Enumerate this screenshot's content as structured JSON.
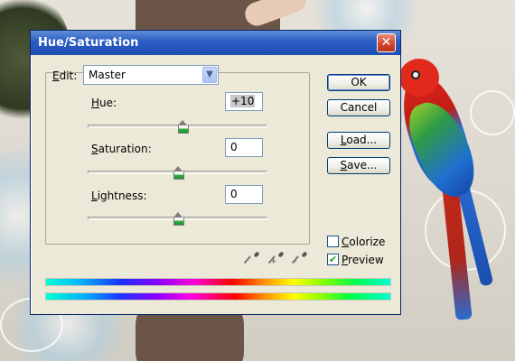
{
  "dialog": {
    "title": "Hue/Saturation",
    "close_glyph": "✕"
  },
  "edit": {
    "label": "Edit:",
    "value": "Master",
    "arrow_glyph": "▼"
  },
  "fields": {
    "hue": {
      "label": "Hue:",
      "value": "+10",
      "slider_value": 10,
      "slider_range": [
        -180,
        180
      ]
    },
    "saturation": {
      "label": "Saturation:",
      "value": "0",
      "slider_value": 0,
      "slider_range": [
        -100,
        100
      ]
    },
    "lightness": {
      "label": "Lightness:",
      "value": "0",
      "slider_value": 0,
      "slider_range": [
        -100,
        100
      ]
    }
  },
  "buttons": {
    "ok": "OK",
    "cancel": "Cancel",
    "load": "Load...",
    "save": "Save..."
  },
  "options": {
    "colorize": {
      "label": "Colorize",
      "checked": false
    },
    "preview": {
      "label": "Preview",
      "checked": true,
      "check_glyph": "✔"
    }
  },
  "icons": {
    "eyedropper": "eyedropper-icon",
    "eyedropper_plus": "eyedropper-plus-icon",
    "eyedropper_minus": "eyedropper-minus-icon",
    "plus_mark": "+",
    "minus_mark": "-"
  },
  "colors": {
    "titlebar": "#2a5cc4",
    "dialog_bg": "#ece9d8",
    "close_button": "#d2472d",
    "thumb_green": "#2fb845"
  }
}
